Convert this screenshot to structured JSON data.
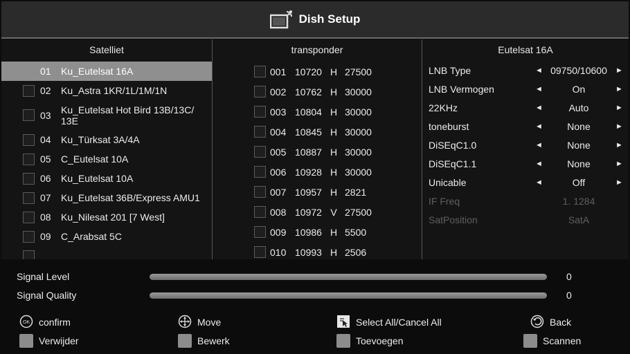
{
  "title": "Dish Setup",
  "icons": {
    "title": "tv-satellite-icon",
    "confirm": "ok-button-icon",
    "move": "move-arrows-icon",
    "select_all": "select-all-icon",
    "back": "back-arrow-icon"
  },
  "satellite_panel": {
    "header": "Satelliet",
    "items": [
      {
        "num": "01",
        "name": "Ku_Eutelsat 16A"
      },
      {
        "num": "02",
        "name": "Ku_Astra 1KR/1L/1M/1N"
      },
      {
        "num": "03",
        "name": "Ku_Eutelsat Hot Bird 13B/13C/ 13E"
      },
      {
        "num": "04",
        "name": "Ku_Türksat 3A/4A"
      },
      {
        "num": "05",
        "name": "C_Eutelsat 10A"
      },
      {
        "num": "06",
        "name": "Ku_Eutelsat 10A"
      },
      {
        "num": "07",
        "name": "Ku_Eutelsat 36B/Express AMU1"
      },
      {
        "num": "08",
        "name": "Ku_Nilesat 201 [7 West]"
      },
      {
        "num": "09",
        "name": "C_Arabsat 5C"
      }
    ]
  },
  "transponder_panel": {
    "header": "transponder",
    "items": [
      {
        "num": "001",
        "freq": "10720",
        "pol": "H",
        "sym": "27500"
      },
      {
        "num": "002",
        "freq": "10762",
        "pol": "H",
        "sym": "30000"
      },
      {
        "num": "003",
        "freq": "10804",
        "pol": "H",
        "sym": "30000"
      },
      {
        "num": "004",
        "freq": "10845",
        "pol": "H",
        "sym": "30000"
      },
      {
        "num": "005",
        "freq": "10887",
        "pol": "H",
        "sym": "30000"
      },
      {
        "num": "006",
        "freq": "10928",
        "pol": "H",
        "sym": "30000"
      },
      {
        "num": "007",
        "freq": "10957",
        "pol": "H",
        "sym": "2821"
      },
      {
        "num": "008",
        "freq": "10972",
        "pol": "V",
        "sym": "27500"
      },
      {
        "num": "009",
        "freq": "10986",
        "pol": "H",
        "sym": "5500"
      },
      {
        "num": "010",
        "freq": "10993",
        "pol": "H",
        "sym": "2506"
      }
    ]
  },
  "lnb_panel": {
    "header": "Eutelsat 16A",
    "left_arrow": "◄",
    "right_arrow": "►",
    "rows": [
      {
        "label": "LNB Type",
        "value": "09750/10600"
      },
      {
        "label": "LNB Vermogen",
        "value": "On"
      },
      {
        "label": "22KHz",
        "value": "Auto"
      },
      {
        "label": "toneburst",
        "value": "None"
      },
      {
        "label": "DiSEqC1.0",
        "value": "None"
      },
      {
        "label": "DiSEqC1.1",
        "value": "None"
      },
      {
        "label": "Unicable",
        "value": "Off"
      },
      {
        "label": "IF Freq",
        "value": "1. 1284"
      },
      {
        "label": "SatPosition",
        "value": "SatA"
      }
    ]
  },
  "signal": {
    "level_label": "Signal Level",
    "level_value": "0",
    "quality_label": "Signal Quality",
    "quality_value": "0"
  },
  "hints": {
    "confirm": "confirm",
    "move": "Move",
    "select_all": "Select All/Cancel All",
    "back": "Back",
    "delete": "Verwijder",
    "edit": "Bewerk",
    "add": "Toevoegen",
    "scan": "Scannen"
  },
  "colors": {
    "selected_row": "#8f8f8f",
    "panel_bg": "#141414",
    "title_bar": "#2b2b2b"
  }
}
